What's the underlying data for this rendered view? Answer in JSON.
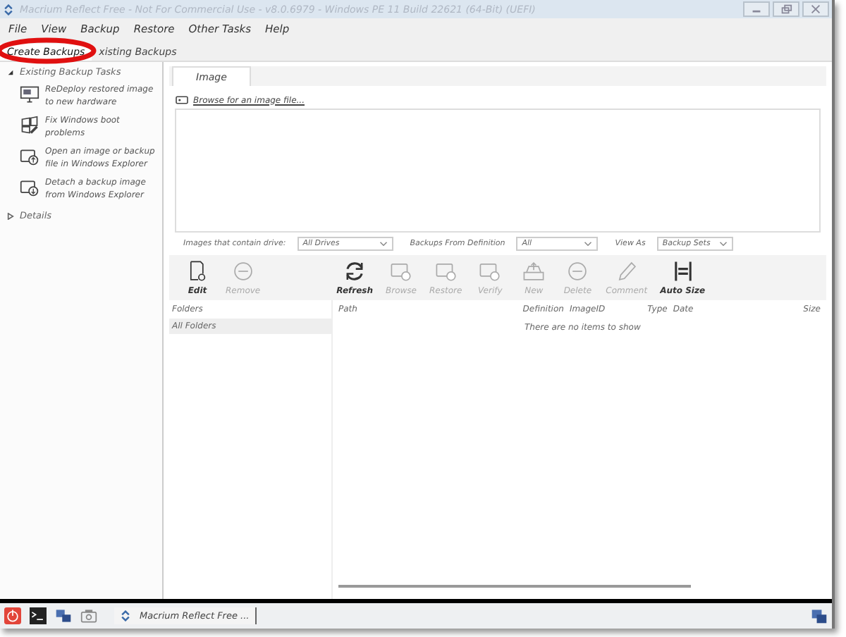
{
  "window": {
    "title": "Macrium Reflect Free - Not For Commercial Use - v8.0.6979 - Windows PE 11 Build 22621 (64-Bit) (UEFI)"
  },
  "menu": [
    "File",
    "View",
    "Backup",
    "Restore",
    "Other Tasks",
    "Help"
  ],
  "tabs": [
    {
      "label": "Create Backups",
      "selected": true,
      "annotated": true
    },
    {
      "label": "xisting Backups",
      "selected": false,
      "annotated": false
    }
  ],
  "sidebar": {
    "section": {
      "label": "Existing Backup Tasks",
      "expanded": true
    },
    "tasks": [
      {
        "kind": "monitor",
        "label": "ReDeploy restored image to new hardware"
      },
      {
        "kind": "repair",
        "label": "Fix Windows boot problems"
      },
      {
        "kind": "open",
        "label": "Open an image or backup file in Windows Explorer"
      },
      {
        "kind": "detach",
        "label": "Detach a backup image from Windows Explorer"
      }
    ],
    "details": {
      "label": "Details",
      "expanded": false
    }
  },
  "image_tab": {
    "label": "Image",
    "browse_link": "Browse for an image file..."
  },
  "filters": [
    {
      "label": "Images that contain drive:",
      "value": "All Drives"
    },
    {
      "label": "Backups From Definition",
      "value": "All"
    },
    {
      "label": "View As",
      "value": "Backup Sets"
    }
  ],
  "toolbar": [
    {
      "kind": "edit",
      "label": "Edit",
      "disabled": false
    },
    {
      "kind": "remove",
      "label": "Remove",
      "disabled": true
    },
    {
      "kind": "gap"
    },
    {
      "kind": "refresh",
      "label": "Refresh",
      "disabled": false
    },
    {
      "kind": "browse",
      "label": "Browse",
      "disabled": true
    },
    {
      "kind": "restore",
      "label": "Restore",
      "disabled": true
    },
    {
      "kind": "verify",
      "label": "Verify",
      "disabled": true
    },
    {
      "kind": "new",
      "label": "New",
      "disabled": true
    },
    {
      "kind": "remove",
      "label": "Delete",
      "disabled": true
    },
    {
      "kind": "comment",
      "label": "Comment",
      "disabled": true
    },
    {
      "kind": "autosize",
      "label": "Auto Size",
      "disabled": false
    }
  ],
  "folders": {
    "column": "Folders",
    "items": [
      {
        "label": "All Folders",
        "selected": true
      }
    ]
  },
  "table": {
    "columns": [
      "Path",
      "Definition",
      "ImageID",
      "Type",
      "Date",
      "Size"
    ],
    "empty_text": "There are no items to show"
  },
  "taskbar": {
    "items": [
      {
        "kind": "power"
      },
      {
        "kind": "console"
      },
      {
        "kind": "network"
      },
      {
        "kind": "camera"
      }
    ],
    "app": "Macrium Reflect Free ..."
  }
}
